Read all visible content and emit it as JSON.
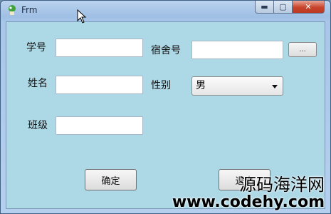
{
  "window": {
    "title": "Frm",
    "min_glyph": "▬",
    "max_glyph": "▢",
    "close_glyph": "✕"
  },
  "form": {
    "student_id_label": "学号",
    "dorm_no_label": "宿舍号",
    "browse_label": "...",
    "name_label": "姓名",
    "gender_label": "性别",
    "gender_value": "男",
    "class_label": "班级",
    "confirm_label": "确定",
    "exit_label": "退出"
  },
  "watermark": {
    "line1": "源码海洋网",
    "line2": "www.codehy.com"
  }
}
